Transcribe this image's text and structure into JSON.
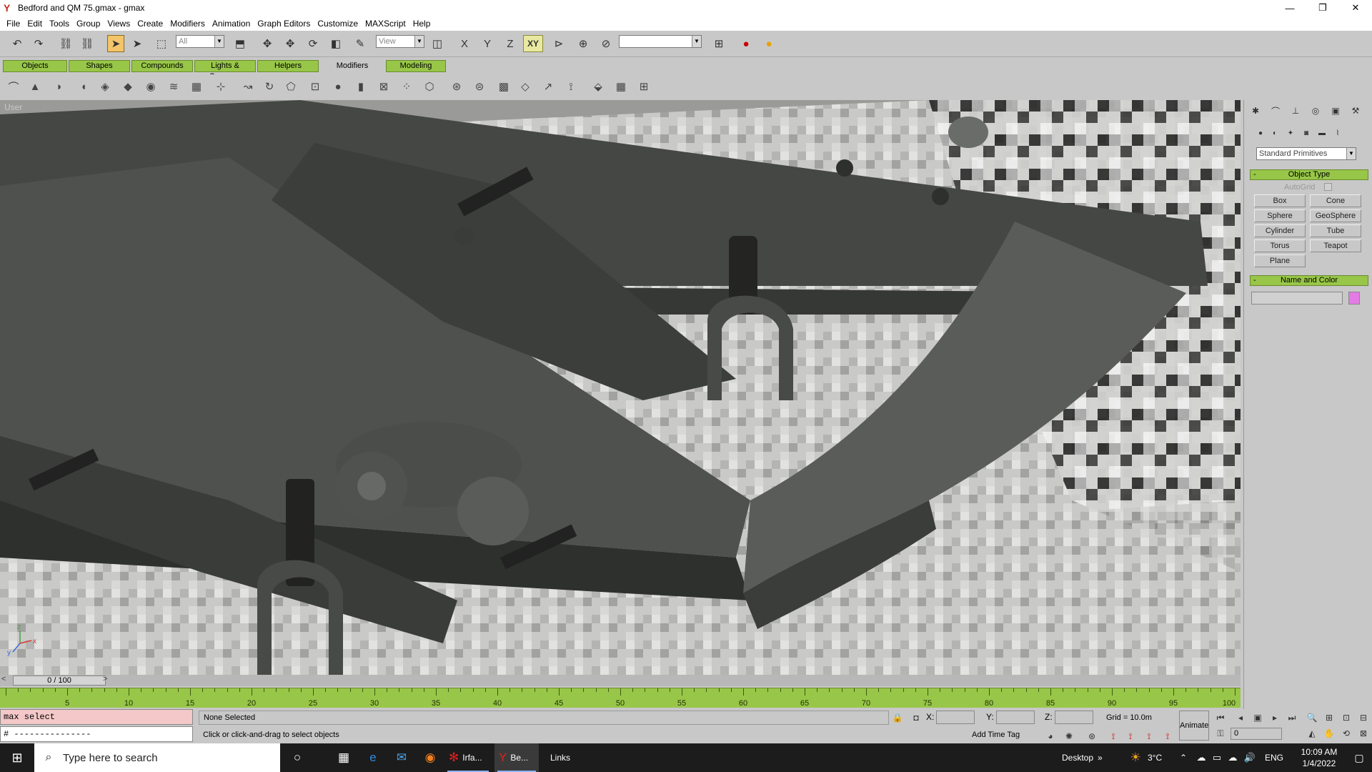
{
  "window": {
    "title": "Bedford and QM 75.gmax - gmax",
    "app_icon": "gmax-icon",
    "minimize": "—",
    "maximize": "❐",
    "close": "✕"
  },
  "menu": [
    "File",
    "Edit",
    "Tools",
    "Group",
    "Views",
    "Create",
    "Modifiers",
    "Animation",
    "Graph Editors",
    "Customize",
    "MAXScript",
    "Help"
  ],
  "toolbar": {
    "selection_filter": "All",
    "ref_coord": "View",
    "named_selection": "",
    "xy_label": "XY",
    "x_label": "X",
    "y_label": "Y",
    "z_label": "Z"
  },
  "tabs": [
    "Objects",
    "Shapes",
    "Compounds",
    "Lights & Cameras",
    "Helpers",
    "Modifiers",
    "Modeling"
  ],
  "selected_tab": "Modifiers",
  "viewport": {
    "label": "User",
    "axis_x": "x",
    "axis_y": "y",
    "axis_z": "z"
  },
  "command_panel": {
    "category": "Standard Primitives",
    "object_type_header": "Object Type",
    "autogrid_label": "AutoGrid",
    "buttons": [
      "Box",
      "Cone",
      "Sphere",
      "GeoSphere",
      "Cylinder",
      "Tube",
      "Torus",
      "Teapot",
      "Plane"
    ],
    "name_color_header": "Name and Color",
    "object_name": "",
    "swatch_color": "#e47ae4"
  },
  "timeline": {
    "frame_label": "0 / 100",
    "prev": "<",
    "next": ">",
    "ticks": [
      "5",
      "10",
      "15",
      "20",
      "25",
      "30",
      "35",
      "40",
      "45",
      "50",
      "55",
      "60",
      "65",
      "70",
      "75",
      "80",
      "85",
      "90",
      "95",
      "100"
    ]
  },
  "status": {
    "listener_line1": "max select",
    "listener_line2": "# ---------------",
    "selection_text": "None Selected",
    "prompt_text": "Click or click-and-drag to select objects",
    "x_label": "X:",
    "y_label": "Y:",
    "z_label": "Z:",
    "grid": "Grid = 10.0m",
    "add_time_tag": "Add Time Tag",
    "animate": "Animate",
    "current_frame": "0"
  },
  "taskbar": {
    "search_placeholder": "Type here to search",
    "apps": [
      {
        "label": "Irfa...",
        "icon": "irfanview-icon"
      },
      {
        "label": "Be...",
        "icon": "gmax-icon"
      }
    ],
    "links": "Links",
    "desktop": "Desktop",
    "weather": "3°C",
    "language": "ENG",
    "time": "10:09 AM",
    "date": "1/4/2022"
  },
  "colors": {
    "accent_green": "#98c648",
    "active_tool": "#f4c46a",
    "taskbar_bg": "#1c1c1c"
  }
}
